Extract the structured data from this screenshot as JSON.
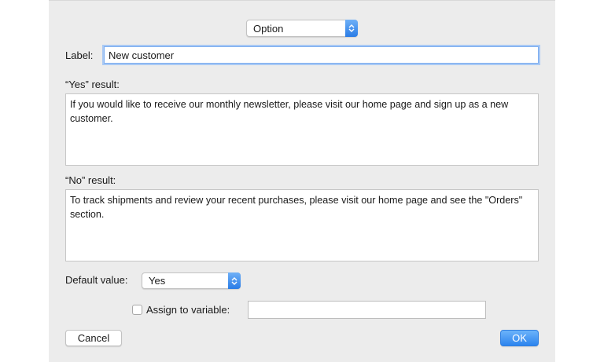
{
  "accent_color": "#2c84ee",
  "option_popup": {
    "value": "Option",
    "icon": "chevron-updown-icon"
  },
  "label_field": {
    "label": "Label:",
    "value": "New customer"
  },
  "yes_result": {
    "label": "“Yes” result:",
    "value": "If you would like to receive our monthly newsletter, please visit our home page and sign up as a new customer."
  },
  "no_result": {
    "label": "“No” result:",
    "value": "To track shipments and review your recent purchases, please visit our home page and see the \"Orders\" section."
  },
  "default_value": {
    "label": "Default value:",
    "value": "Yes",
    "icon": "chevron-updown-icon"
  },
  "assign_variable": {
    "label": "Assign to variable:",
    "checked": false,
    "value": ""
  },
  "buttons": {
    "cancel": "Cancel",
    "ok": "OK"
  }
}
